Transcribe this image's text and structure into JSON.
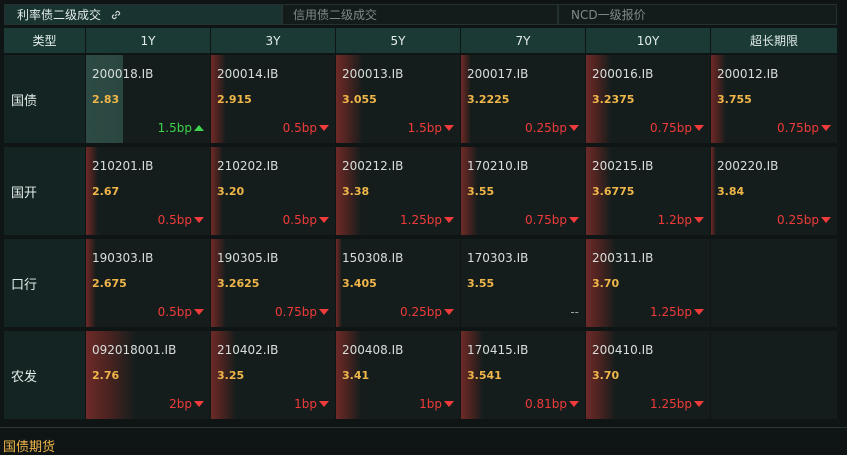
{
  "tabs": [
    {
      "label": "利率债二级成交",
      "active": true,
      "icon": "link-icon"
    },
    {
      "label": "信用债二级成交",
      "active": false
    },
    {
      "label": "NCD一级报价",
      "active": false
    }
  ],
  "table": {
    "type_header": "类型",
    "columns": [
      "1Y",
      "3Y",
      "5Y",
      "7Y",
      "10Y",
      "超长期限"
    ],
    "rows": [
      {
        "label": "国债",
        "cells": [
          {
            "code": "200018.IB",
            "yield": "2.83",
            "change": "1.5bp",
            "dir": "up",
            "bar": 0.3
          },
          {
            "code": "200014.IB",
            "yield": "2.915",
            "change": "0.5bp",
            "dir": "down",
            "bar": 0.12
          },
          {
            "code": "200013.IB",
            "yield": "3.055",
            "change": "1.5bp",
            "dir": "down",
            "bar": 0.22
          },
          {
            "code": "200017.IB",
            "yield": "3.2225",
            "change": "0.25bp",
            "dir": "down",
            "bar": 0.08
          },
          {
            "code": "200016.IB",
            "yield": "3.2375",
            "change": "0.75bp",
            "dir": "down",
            "bar": 0.2
          },
          {
            "code": "200012.IB",
            "yield": "3.755",
            "change": "0.75bp",
            "dir": "down",
            "bar": 0.12
          }
        ]
      },
      {
        "label": "国开",
        "cells": [
          {
            "code": "210201.IB",
            "yield": "2.67",
            "change": "0.5bp",
            "dir": "down",
            "bar": 0.1
          },
          {
            "code": "210202.IB",
            "yield": "3.20",
            "change": "0.5bp",
            "dir": "down",
            "bar": 0.1
          },
          {
            "code": "200212.IB",
            "yield": "3.38",
            "change": "1.25bp",
            "dir": "down",
            "bar": 0.2
          },
          {
            "code": "170210.IB",
            "yield": "3.55",
            "change": "0.75bp",
            "dir": "down",
            "bar": 0.14
          },
          {
            "code": "200215.IB",
            "yield": "3.6775",
            "change": "1.2bp",
            "dir": "down",
            "bar": 0.2
          },
          {
            "code": "200220.IB",
            "yield": "3.84",
            "change": "0.25bp",
            "dir": "down",
            "bar": 0.04
          }
        ]
      },
      {
        "label": "口行",
        "cells": [
          {
            "code": "190303.IB",
            "yield": "2.675",
            "change": "0.5bp",
            "dir": "down",
            "bar": 0.08
          },
          {
            "code": "190305.IB",
            "yield": "3.2625",
            "change": "0.75bp",
            "dir": "down",
            "bar": 0.12
          },
          {
            "code": "150308.IB",
            "yield": "3.405",
            "change": "0.25bp",
            "dir": "down",
            "bar": 0.05
          },
          {
            "code": "170303.IB",
            "yield": "3.55",
            "change": "--",
            "dir": "flat",
            "bar": 0
          },
          {
            "code": "200311.IB",
            "yield": "3.70",
            "change": "1.25bp",
            "dir": "down",
            "bar": 0.24
          },
          {
            "code": "",
            "yield": "",
            "change": "",
            "dir": "none",
            "bar": 0
          }
        ]
      },
      {
        "label": "农发",
        "cells": [
          {
            "code": "092018001.IB",
            "yield": "2.76",
            "change": "2bp",
            "dir": "down",
            "bar": 0.4
          },
          {
            "code": "210402.IB",
            "yield": "3.25",
            "change": "1bp",
            "dir": "down",
            "bar": 0.2
          },
          {
            "code": "200408.IB",
            "yield": "3.41",
            "change": "1bp",
            "dir": "down",
            "bar": 0.2
          },
          {
            "code": "170415.IB",
            "yield": "3.541",
            "change": "0.81bp",
            "dir": "down",
            "bar": 0.18
          },
          {
            "code": "200410.IB",
            "yield": "3.70",
            "change": "1.25bp",
            "dir": "down",
            "bar": 0.24
          },
          {
            "code": "",
            "yield": "",
            "change": "",
            "dir": "none",
            "bar": 0
          }
        ]
      }
    ]
  },
  "bottom": {
    "title": "国债期货"
  },
  "colors": {
    "down": "#ef3b3b",
    "up": "#3ed24d",
    "yield": "#f0b64a",
    "header_bg": "#1b3a36"
  }
}
